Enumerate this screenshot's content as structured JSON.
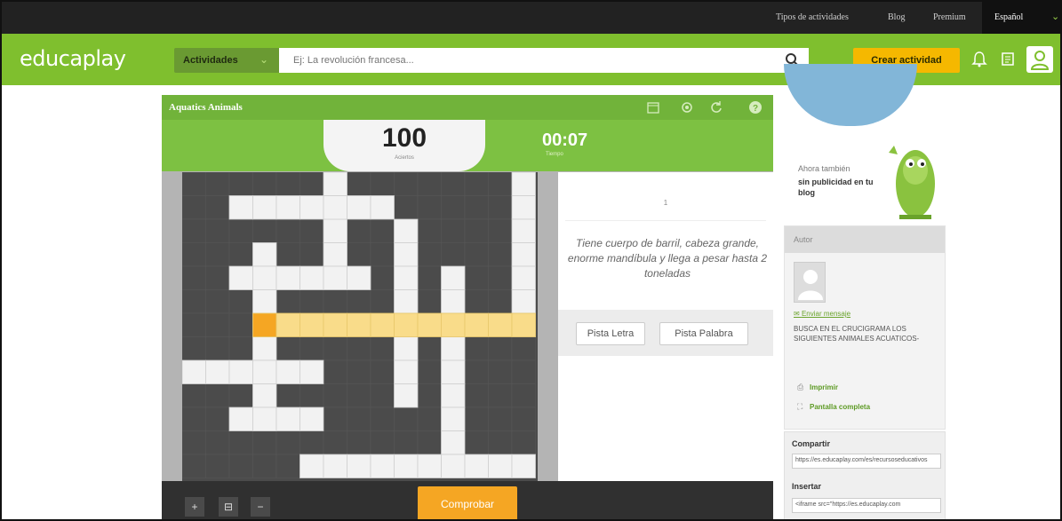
{
  "topbar": {
    "links": [
      "Tipos de actividades",
      "Blog",
      "Premium"
    ],
    "language": "Español"
  },
  "header": {
    "logo_a": "educa",
    "logo_b": "play",
    "activities_label": "Actividades",
    "search_placeholder": "Ej: La revolución francesa...",
    "create_label": "Crear actividad"
  },
  "game": {
    "title": "Aquatics Animals",
    "score": "100",
    "score_label": "Aciertos",
    "time": "00:07",
    "time_label": "Tiempo",
    "clue_number": "1",
    "clue_text": "Tiene cuerpo de barril, cabeza grande, enorme mandíbula y llega a pesar hasta 2 toneladas",
    "hint_letter": "Pista Letra",
    "hint_word": "Pista Palabra",
    "check_label": "Comprobar",
    "zoom_in": "+",
    "zoom_reset": "⊟",
    "zoom_out": "−"
  },
  "sidebar": {
    "promo_line1": "Ahora también",
    "promo_line2": "sin publicidad en tu blog",
    "author_header": "Autor",
    "send_message": "Enviar mensaje",
    "description": "BUSCA EN EL CRUCIGRAMA LOS SIGUIENTES ANIMALES ACUATICOS-",
    "print_label": "Imprimir",
    "fullscreen_label": "Pantalla completa",
    "share_label": "Compartir",
    "share_value": "https://es.educaplay.com/es/recursoseducativos",
    "embed_label": "Insertar",
    "embed_value": "<iframe src=\"https://es.educaplay.com"
  },
  "colors": {
    "brand_green": "#7fbf2e",
    "accent_yellow": "#f5b800",
    "highlight_row": "#f9dc8a",
    "active_cell": "#f5a623"
  }
}
